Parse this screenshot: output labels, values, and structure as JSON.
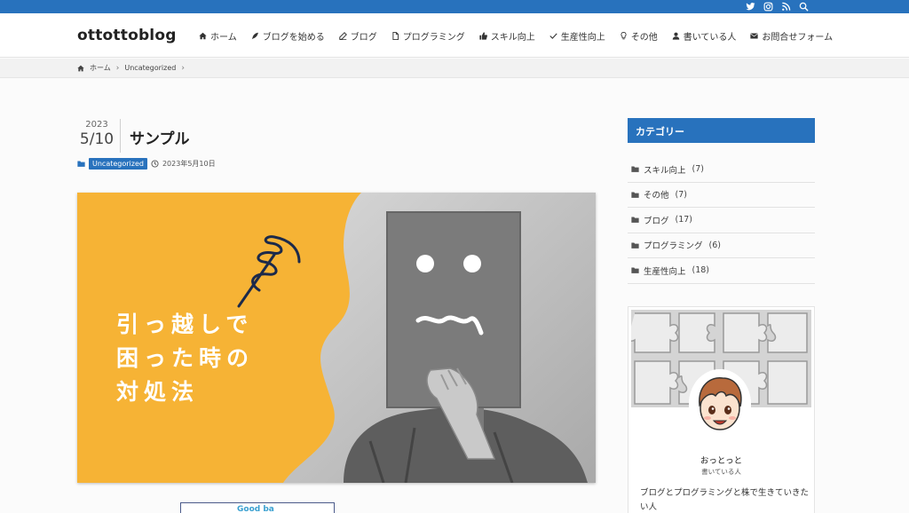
{
  "site": {
    "logo": "ottottoblog"
  },
  "topbar": {
    "icons": [
      "twitter-icon",
      "instagram-icon",
      "rss-icon",
      "search-icon"
    ],
    "color": "#2872bd"
  },
  "nav": {
    "items": [
      {
        "label": "ホーム",
        "icon": "home-icon"
      },
      {
        "label": "ブログを始める",
        "icon": "feather-icon"
      },
      {
        "label": "ブログ",
        "icon": "pen-icon"
      },
      {
        "label": "プログラミング",
        "icon": "file-icon"
      },
      {
        "label": "スキル向上",
        "icon": "thumbs-up-icon"
      },
      {
        "label": "生産性向上",
        "icon": "check-icon"
      },
      {
        "label": "その他",
        "icon": "lightbulb-icon"
      },
      {
        "label": "書いている人",
        "icon": "user-icon"
      },
      {
        "label": "お問合せフォーム",
        "icon": "mail-icon"
      }
    ]
  },
  "breadcrumb": {
    "home": "ホーム",
    "current": "Uncategorized"
  },
  "post": {
    "year": "2023",
    "month_day": "5/10",
    "title": "サンプル",
    "category": "Uncategorized",
    "date": "2023年5月10日",
    "hero_text": "引っ越しで\n困った時の\n対処法"
  },
  "below_frame_text": "Good ba",
  "sidebar": {
    "heading": "カテゴリー",
    "categories": [
      {
        "label": "スキル向上",
        "count": "(7)"
      },
      {
        "label": "その他",
        "count": "(7)"
      },
      {
        "label": "ブログ",
        "count": "(17)"
      },
      {
        "label": "プログラミング",
        "count": "(6)"
      },
      {
        "label": "生産性向上",
        "count": "(18)"
      }
    ]
  },
  "profile": {
    "name": "おっとっと",
    "role": "書いている人",
    "description": "ブログとプログラミングと株で生きていきたい人"
  },
  "colors": {
    "accent": "#2872bd",
    "hero_bg": "#f6b335"
  }
}
